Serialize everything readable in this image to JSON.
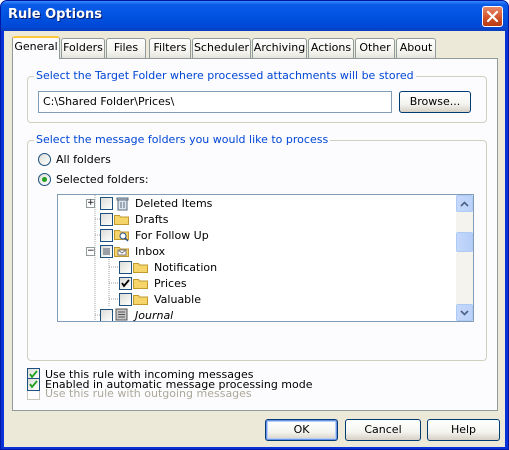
{
  "window": {
    "title": "Rule Options"
  },
  "tabs": [
    {
      "label": "General"
    },
    {
      "label": "Folders"
    },
    {
      "label": "Files"
    },
    {
      "label": "Filters"
    },
    {
      "label": "Scheduler"
    },
    {
      "label": "Archiving"
    },
    {
      "label": "Actions"
    },
    {
      "label": "Other"
    },
    {
      "label": "About"
    }
  ],
  "active_tab": "General",
  "target_folder": {
    "legend": "Select the Target Folder where processed attachments will be stored",
    "path_value": "C:\\Shared Folder\\Prices\\",
    "browse_label": "Browse..."
  },
  "message_folders": {
    "legend": "Select the message folders you would like to process",
    "all_folders_label": "All folders",
    "selected_folders_label": "Selected folders:",
    "selected_option": "Selected folders:",
    "tree": [
      {
        "label": "Deleted Items",
        "checked": false,
        "icon": "deleted-items-icon",
        "expander": "+"
      },
      {
        "label": "Drafts",
        "checked": false,
        "icon": "folder-icon"
      },
      {
        "label": "For Follow Up",
        "checked": false,
        "icon": "search-folder-icon"
      },
      {
        "label": "Inbox",
        "checked": "partial",
        "icon": "inbox-icon",
        "expander": "−"
      },
      {
        "label": "Notification",
        "checked": false,
        "icon": "folder-icon"
      },
      {
        "label": "Prices",
        "checked": true,
        "icon": "folder-icon"
      },
      {
        "label": "Valuable",
        "checked": false,
        "icon": "folder-icon"
      },
      {
        "label": "Journal",
        "checked": false,
        "icon": "journal-icon"
      }
    ]
  },
  "options": {
    "incoming_label": "Use this rule with incoming messages",
    "incoming_checked": true,
    "outgoing_label": "Use this rule with outgoing messages",
    "outgoing_checked": false,
    "automatic_label": "Enabled in automatic message processing mode",
    "automatic_checked": true
  },
  "buttons": {
    "ok": "OK",
    "cancel": "Cancel",
    "help": "Help"
  },
  "colors": {
    "title_bar": "#0053e1",
    "legend_text": "#0046d5",
    "active_tab_accent": "#ffc83c",
    "checkmark": "#21a121"
  }
}
